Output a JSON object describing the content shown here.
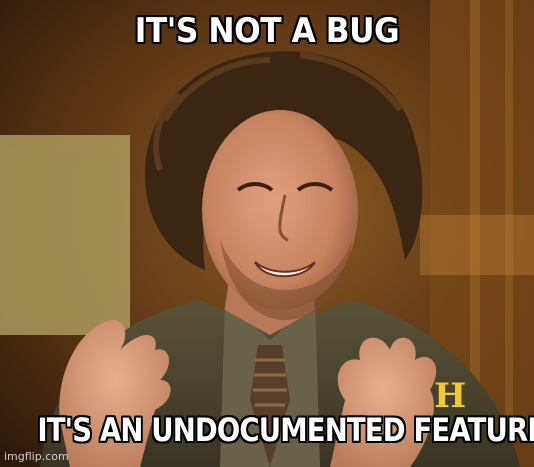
{
  "meme": {
    "top_text": "IT'S NOT A BUG",
    "bottom_text": "IT'S AN UNDOCUMENTED FEATURE",
    "watermark": "imgflip.com"
  },
  "scene": {
    "subject": "man-with-wild-hair-gesturing",
    "channel_logo_letter": "H"
  },
  "colors": {
    "text": "#ffffff",
    "outline": "#000000",
    "background": "#5a3a18",
    "suit": "#4a4332",
    "skin": "#c98a6a",
    "logo": "#f0c838"
  }
}
